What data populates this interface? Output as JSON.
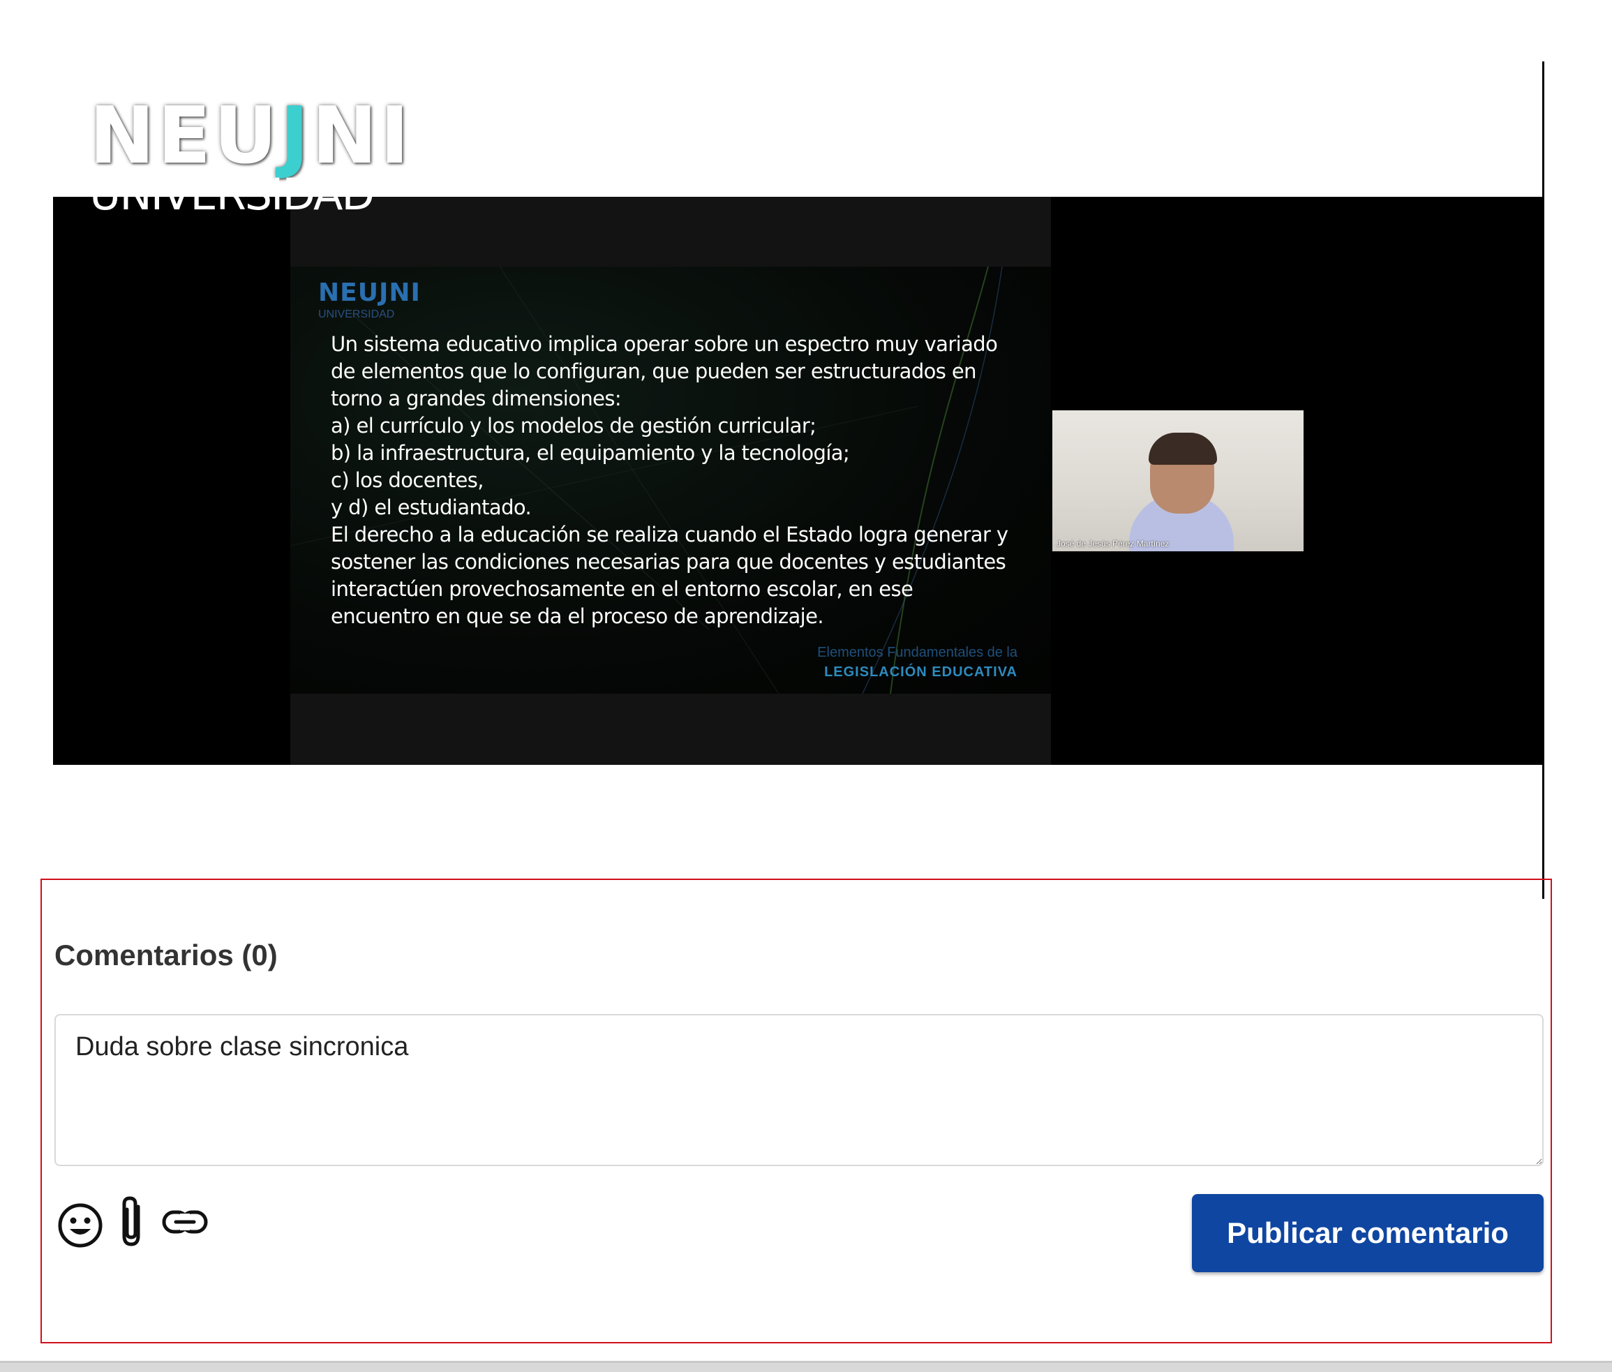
{
  "logo": {
    "main_pre": "NEU",
    "main_j": "J",
    "main_post": "NI",
    "sub": "UNIVERSIDAD"
  },
  "slide": {
    "logo_text": "NEUJNI",
    "logo_sub": "UNIVERSIDAD",
    "lines": [
      "Un sistema educativo implica operar sobre un espectro muy variado",
      "de elementos que lo configuran, que pueden ser estructurados en",
      "torno a grandes dimensiones:",
      "a) el currículo y los modelos de gestión curricular;",
      "b) la infraestructura, el equipamiento y la tecnología;",
      "c) los docentes,",
      "y d) el estudiantado.",
      "El derecho a la educación se realiza cuando el Estado logra generar y",
      "sostener las condiciones necesarias para que docentes y estudiantes",
      "interactúen provechosamente en el entorno escolar, en ese",
      "encuentro en que se da el proceso de aprendizaje."
    ],
    "footer_line1": "Elementos Fundamentales de la",
    "footer_line2": "LEGISLACIÓN EDUCATIVA"
  },
  "webcam": {
    "name": "José de Jesús Pérez Martínez"
  },
  "comments": {
    "title": "Comentarios (0)",
    "input_value": "Duda sobre clase sincronica",
    "publish_label": "Publicar comentario",
    "tools": [
      "emoji-icon",
      "paperclip-icon",
      "link-icon"
    ]
  },
  "colors": {
    "accent_button": "#0f46a1",
    "highlight_border": "#d0101c",
    "logo_accent": "#3ccfcf"
  }
}
